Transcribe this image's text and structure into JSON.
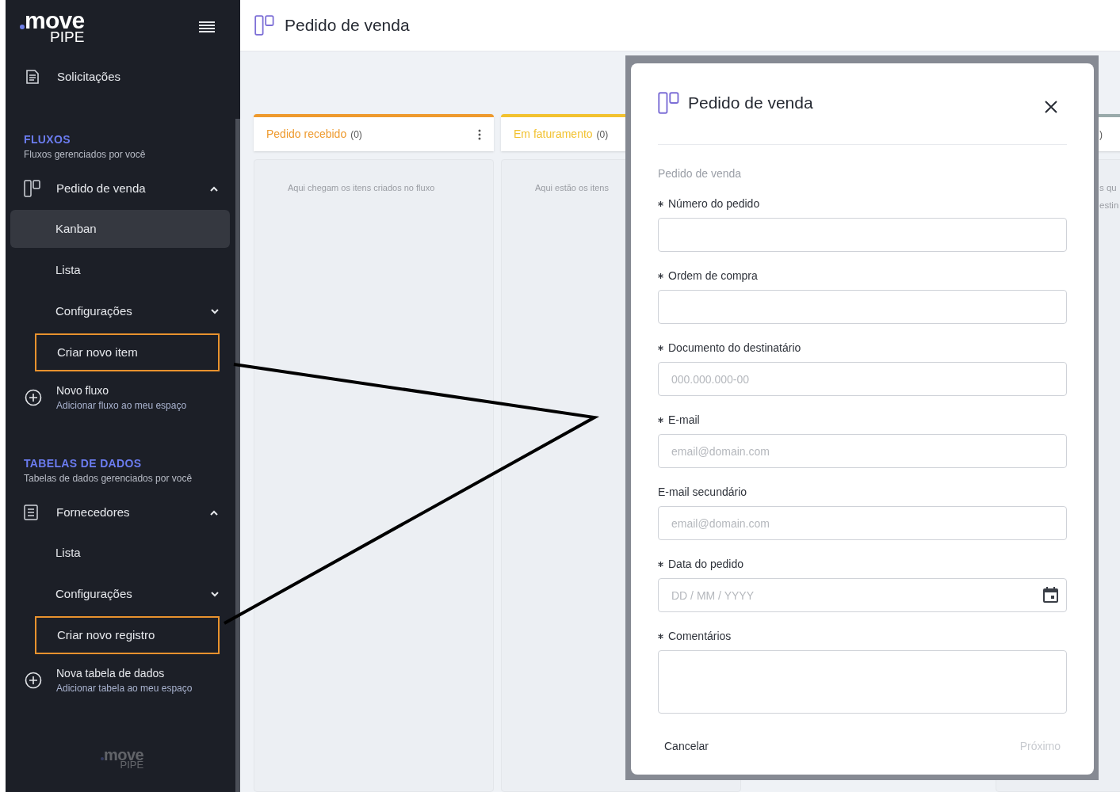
{
  "sidebar": {
    "logo": {
      "word": "move",
      "sub": "PIPE"
    },
    "top_items": [
      {
        "label": "Solicitações"
      }
    ],
    "sections": [
      {
        "title": "FLUXOS",
        "subtitle": "Fluxos gerenciados por você",
        "groups": [
          {
            "label": "Pedido de venda",
            "kind": "board",
            "expanded": true,
            "children": [
              {
                "label": "Kanban",
                "kind": "link",
                "selected": true,
                "highlighted": false
              },
              {
                "label": "Lista",
                "kind": "link",
                "selected": false,
                "highlighted": false
              },
              {
                "label": "Configurações",
                "kind": "submenu",
                "expanded": false,
                "selected": false,
                "highlighted": false
              },
              {
                "label": "Criar novo item",
                "kind": "link",
                "selected": false,
                "highlighted": true
              }
            ]
          }
        ],
        "add": {
          "label": "Novo fluxo",
          "description": "Adicionar fluxo ao meu espaço"
        }
      },
      {
        "title": "TABELAS DE DADOS",
        "subtitle": "Tabelas de dados gerenciados por você",
        "groups": [
          {
            "label": "Fornecedores",
            "kind": "table",
            "expanded": true,
            "children": [
              {
                "label": "Lista",
                "kind": "link",
                "selected": false,
                "highlighted": false
              },
              {
                "label": "Configurações",
                "kind": "submenu",
                "expanded": false,
                "selected": false,
                "highlighted": false
              },
              {
                "label": "Criar novo registro",
                "kind": "link",
                "selected": false,
                "highlighted": true
              }
            ]
          }
        ],
        "add": {
          "label": "Nova tabela de dados",
          "description": "Adicionar tabela ao meu espaço"
        }
      }
    ],
    "footer_logo": {
      "word": "move",
      "sub": "PIPE"
    }
  },
  "page": {
    "title": "Pedido de venda"
  },
  "board": {
    "columns": [
      {
        "title": "Pedido recebido",
        "count": "(0)",
        "color": "#ee9a2e",
        "menu": true,
        "empty_text": [
          "Aqui chegam os itens criados no fluxo"
        ]
      },
      {
        "title": "Em faturamento",
        "count": "(0)",
        "color": "#f2c230",
        "empty_text": [
          "Aqui estão os itens"
        ]
      }
    ],
    "partial_column": {
      "count": ")",
      "empty_text": [
        "s qu",
        "estin"
      ]
    }
  },
  "modal": {
    "title": "Pedido de venda",
    "section": "Pedido de venda",
    "fields": [
      {
        "label": "Número do pedido",
        "required": true,
        "kind": "text"
      },
      {
        "label": "Ordem de compra",
        "required": true,
        "kind": "text"
      },
      {
        "label": "Documento do destinatário",
        "required": true,
        "kind": "text",
        "placeholder": "000.000.000-00"
      },
      {
        "label": "E-mail",
        "required": true,
        "kind": "text",
        "placeholder": "email@domain.com"
      },
      {
        "label": "E-mail secundário",
        "required": false,
        "kind": "text",
        "placeholder": "email@domain.com"
      },
      {
        "label": "Data do pedido",
        "required": true,
        "kind": "date",
        "placeholder": "DD / MM / YYYY"
      },
      {
        "label": "Comentários",
        "required": true,
        "kind": "textarea"
      }
    ],
    "buttons": [
      {
        "label": "Cancelar",
        "disabled": false
      },
      {
        "label": "Próximo",
        "disabled": true
      }
    ]
  }
}
